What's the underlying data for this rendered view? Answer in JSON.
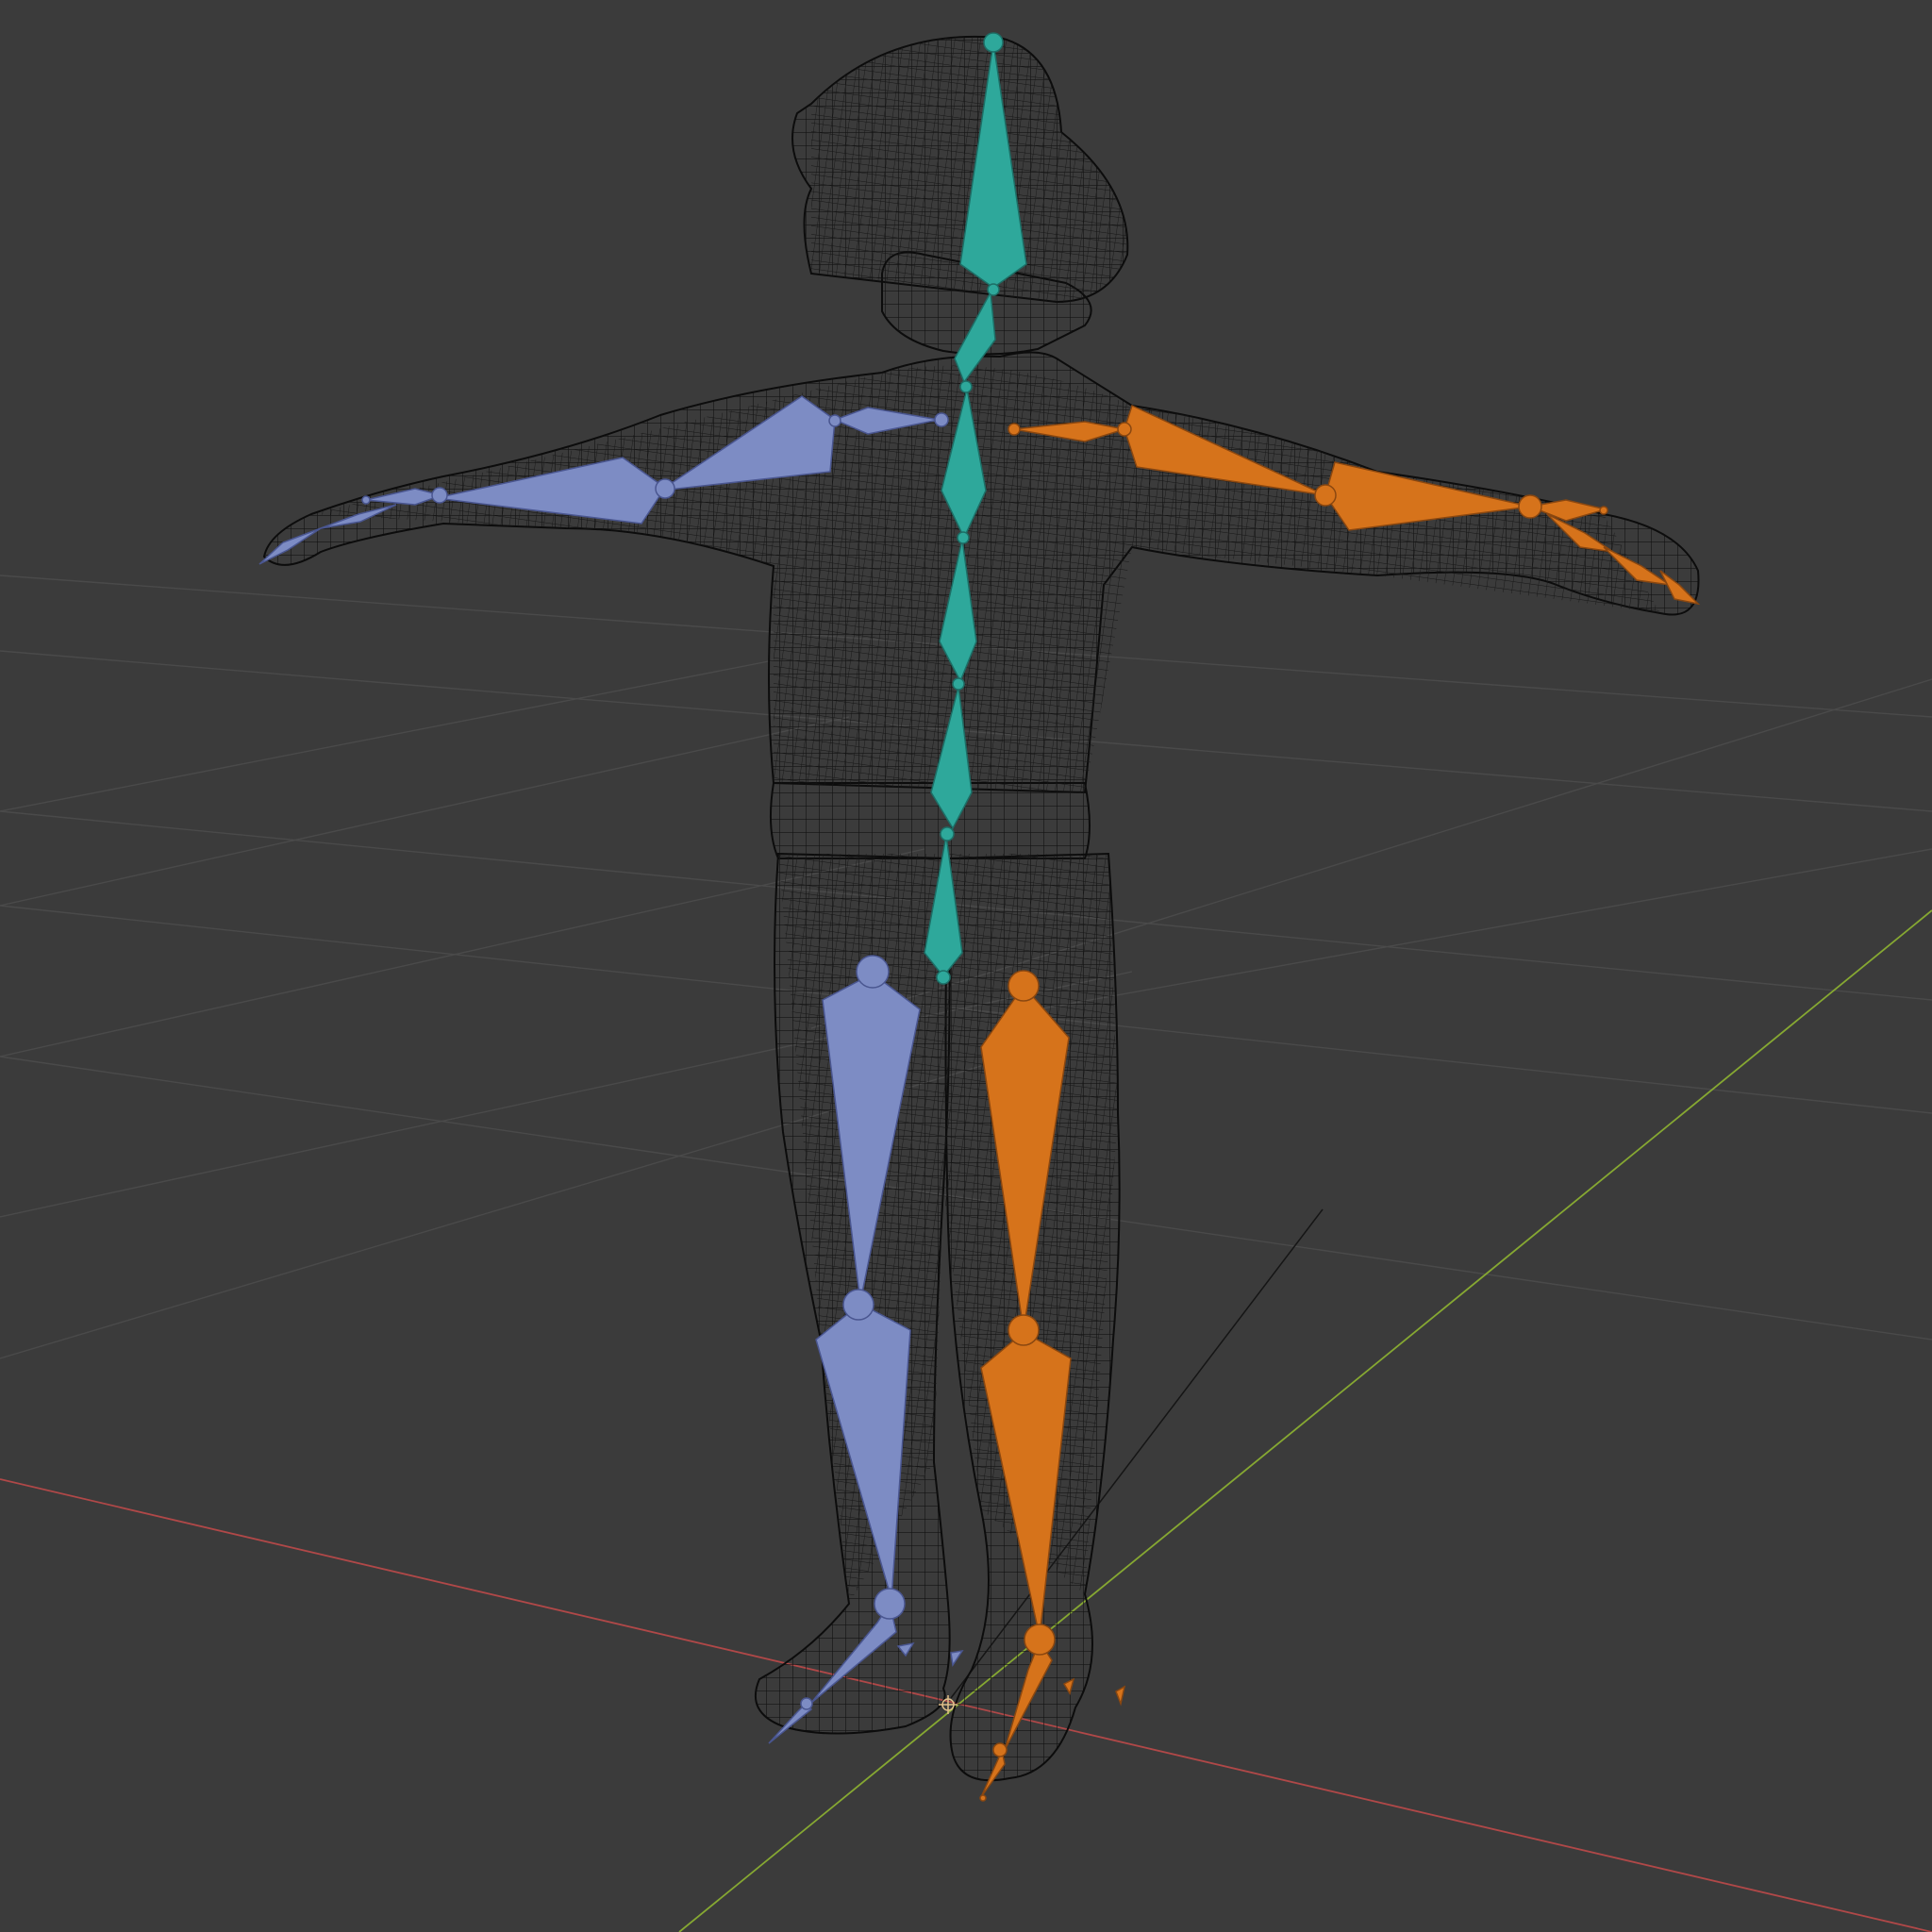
{
  "viewport": {
    "background": "#3b3b3b",
    "grid_color": "#4a4a4a",
    "x_axis_color": "#b04848",
    "y_axis_color": "#86a832"
  },
  "armature": {
    "spine_color": "#2ea89b",
    "left_side_color": "#7d8cc4",
    "right_side_color": "#d6731b"
  },
  "mesh": {
    "wire_color": "#111111"
  }
}
